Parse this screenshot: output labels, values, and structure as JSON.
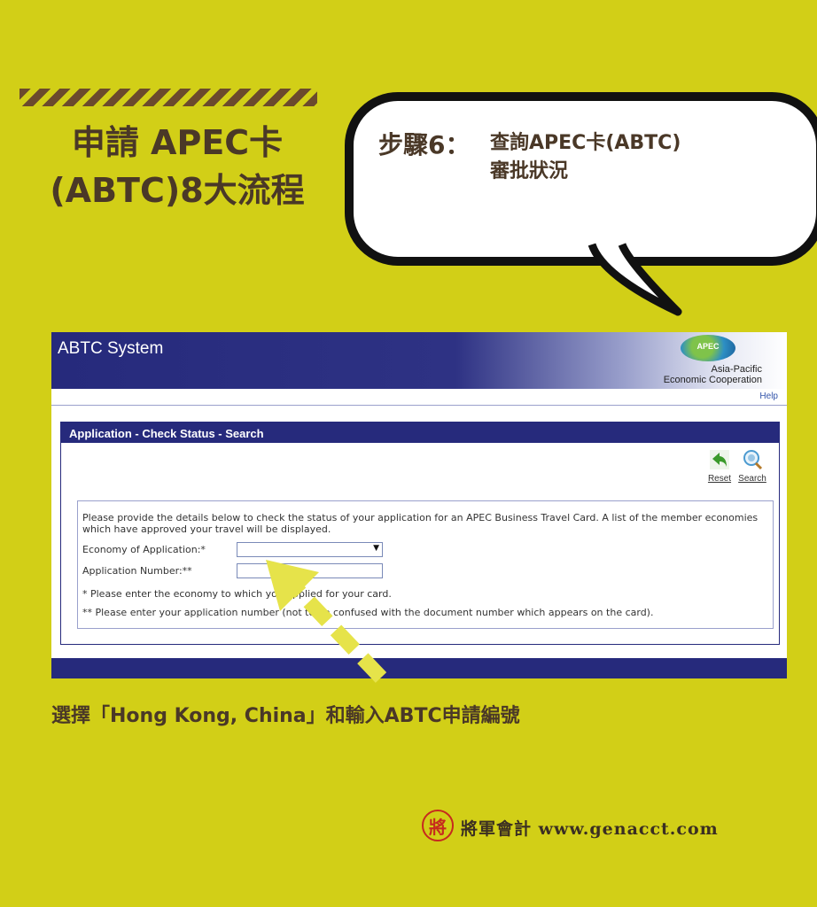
{
  "poster": {
    "title_line1": "申請 APEC卡",
    "title_line2": "(ABTC)8大流程",
    "step_label": "步驟6：",
    "step_line1": "查詢APEC卡(ABTC)",
    "step_line2": "審批狀況",
    "caption": "選擇「Hong Kong, China」和輸入ABTC申請編號",
    "brand_seal": "將",
    "brand_name": "將軍會計 www.genacct.com"
  },
  "window": {
    "app_title": "ABTC System",
    "logo_text": "APEC",
    "org_line1": "Asia-Pacific",
    "org_line2": "Economic Cooperation",
    "help_link": "Help",
    "panel_title": "Application - Check Status - Search",
    "toolbar": {
      "reset_label": "Reset",
      "search_label": "Search"
    },
    "intro_text": "Please provide the details below to check the status of your application for an APEC Business Travel Card. A list of the member economies which have approved your travel will be displayed.",
    "economy_label": "Economy of Application:*",
    "economy_value": "",
    "app_number_label": "Application Number:**",
    "app_number_value": "",
    "note1": "* Please enter the economy to which you applied for your card.",
    "note2": "** Please enter your application number (not to be confused with the document number which appears on the card)."
  },
  "colors": {
    "background": "#d2cf17",
    "brown_text": "#4a3827",
    "navy": "#262a7c",
    "arrow": "#e6e34a"
  }
}
